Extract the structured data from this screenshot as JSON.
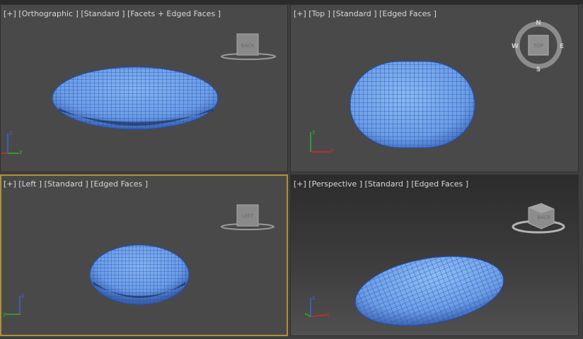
{
  "viewports": [
    {
      "id": "orthographic",
      "label": "[+] [Orthographic ] [Standard ] [Facets + Edged Faces ]",
      "navcube": "BACK",
      "axes": {
        "up": "z",
        "right": "y"
      }
    },
    {
      "id": "top",
      "label": "[+] [Top ] [Standard ] [Edged Faces ]",
      "navcube": "TOP",
      "compass": {
        "n": "N",
        "s": "S",
        "e": "E",
        "w": "W"
      },
      "axes": {
        "up": "y",
        "right": "x"
      }
    },
    {
      "id": "left",
      "label": "[+] [Left ] [Standard ] [Edged Faces ]",
      "navcube": "LEFT",
      "axes": {
        "up": "z",
        "right": "y"
      }
    },
    {
      "id": "perspective",
      "label": "[+] [Perspective ] [Standard ] [Edged Faces ]",
      "navcube": "BACK",
      "axes": {
        "up": "z",
        "right": "x"
      }
    }
  ],
  "colors": {
    "mesh_fill": "#6d9ee3",
    "mesh_wire": "#1f4fc4",
    "active_border": "#b08e3c",
    "axis_x": "#d62a2a",
    "axis_y": "#2ab52a",
    "axis_z": "#3a62e0"
  }
}
